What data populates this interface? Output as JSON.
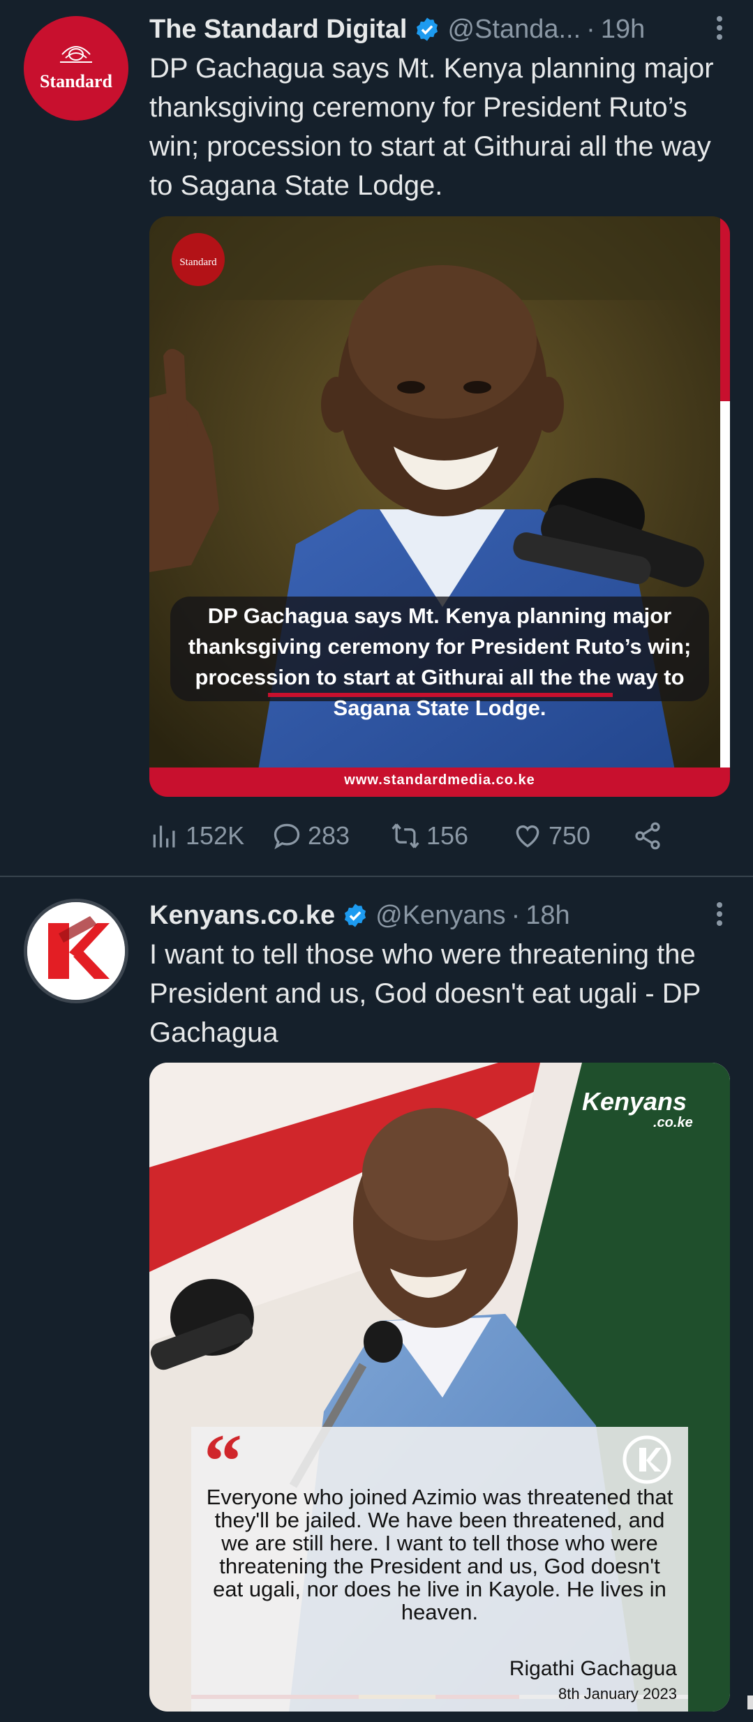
{
  "tweet1": {
    "display_name": "The Standard Digital",
    "handle": "@Standa...",
    "time": "19h",
    "avatar_text": "Standard",
    "text": "DP Gachagua says Mt. Kenya planning major thanksgiving ceremony for President Ruto’s win; procession to start at Githurai all the way to Sagana State Lodge.",
    "image": {
      "logo_text": "Standard",
      "caption": "DP Gachagua says Mt. Kenya planning major thanksgiving ceremony for President Ruto’s win; procession to start at Githurai all the the way to Sagana State Lodge.",
      "footer_url": "www.standardmedia.co.ke"
    },
    "stats": {
      "views": "152K",
      "replies": "283",
      "retweets": "156",
      "likes": "750"
    }
  },
  "tweet2": {
    "display_name": "Kenyans.co.ke",
    "handle": "@Kenyans",
    "time": "18h",
    "text": "I want to tell those who were threatening the President and us, God doesn't eat ugali - DP Gachagua",
    "image": {
      "logo_text": "Kenyans",
      "logo_sub": ".co.ke",
      "quote_mark": "“",
      "quote": "Everyone who joined Azimio was threatened that they'll be jailed. We have been threatened, and we are still here. I want to tell those who were threatening the President and us, God doesn't eat ugali, nor does he live in Kayole. He lives in heaven.",
      "author": "Rigathi Gachagua",
      "date": "8th January 2023"
    }
  },
  "colors": {
    "background": "#15202b",
    "secondary_text": "#8b98a5",
    "verified": "#1d9bf0",
    "standard_red": "#c8102e",
    "kenyans_red": "#e31e24"
  },
  "icons": [
    "verified-badge-icon",
    "more-options-icon",
    "views-icon",
    "reply-icon",
    "retweet-icon",
    "like-icon",
    "share-icon"
  ]
}
